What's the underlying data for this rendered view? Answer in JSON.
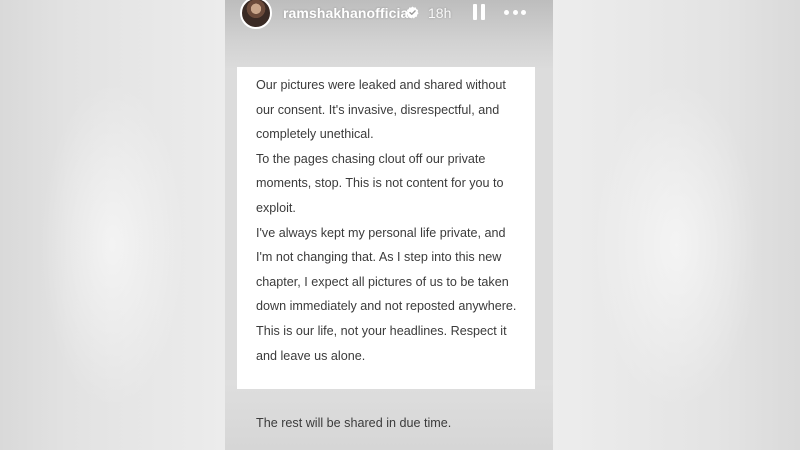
{
  "story": {
    "username": "ramshakhanofficial",
    "verified": true,
    "timestamp": "18h",
    "paragraphs": [
      "Our pictures were leaked and shared without our consent. It's invasive, disrespectful, and completely unethical.",
      "To the pages chasing clout off our private moments, stop. This is not content for you to exploit.",
      "I've always kept my personal life private, and I'm not changing that. As I step into this new chapter, I expect all pictures of us to be taken down immediately and not reposted anywhere.",
      "This is our life, not your headlines. Respect it and leave us alone."
    ],
    "closing_line": "The rest will be shared in due time."
  },
  "icons": {
    "verified": "verified-badge-icon",
    "pause": "pause-icon",
    "more": "more-options-icon"
  },
  "colors": {
    "text": "#3b3b3b",
    "card": "#ffffff",
    "story_bg": "#dcdcdc",
    "verified": "#ffffff"
  }
}
